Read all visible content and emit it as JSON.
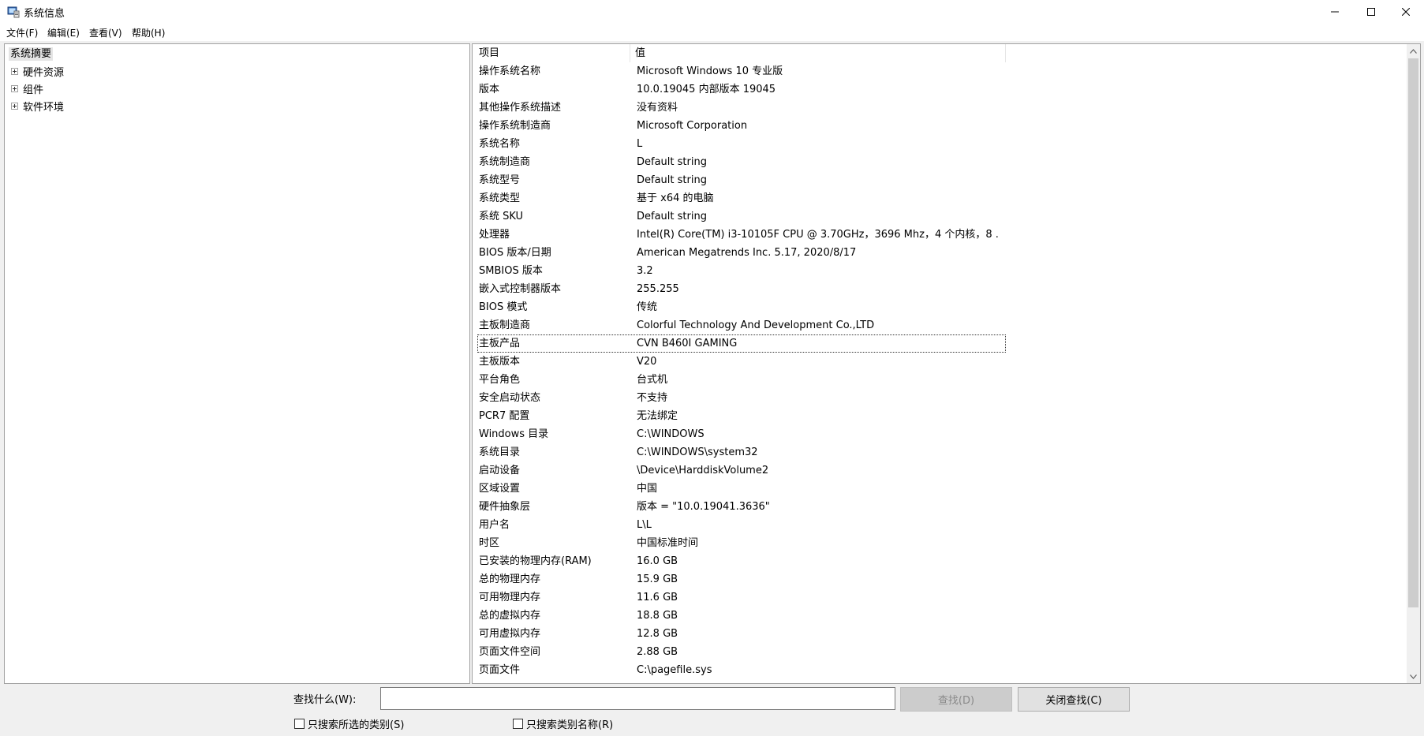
{
  "window": {
    "title": "系统信息",
    "minimize_glyph": "—",
    "maximize_glyph": "☐",
    "close_glyph": "✕"
  },
  "menu": [
    "文件(F)",
    "编辑(E)",
    "查看(V)",
    "帮助(H)"
  ],
  "tree": {
    "root": "系统摘要",
    "children": [
      "硬件资源",
      "组件",
      "软件环境"
    ]
  },
  "list": {
    "columns": {
      "item": "项目",
      "value": "值"
    },
    "focused_index": 15,
    "rows": [
      {
        "item": "操作系统名称",
        "value": "Microsoft Windows 10 专业版"
      },
      {
        "item": "版本",
        "value": "10.0.19045 内部版本 19045"
      },
      {
        "item": "其他操作系统描述",
        "value": "没有资料"
      },
      {
        "item": "操作系统制造商",
        "value": "Microsoft Corporation"
      },
      {
        "item": "系统名称",
        "value": "L"
      },
      {
        "item": "系统制造商",
        "value": "Default string"
      },
      {
        "item": "系统型号",
        "value": "Default string"
      },
      {
        "item": "系统类型",
        "value": "基于 x64 的电脑"
      },
      {
        "item": "系统 SKU",
        "value": "Default string"
      },
      {
        "item": "处理器",
        "value": "Intel(R) Core(TM) i3-10105F CPU @ 3.70GHz，3696 Mhz，4 个内核，8 ..."
      },
      {
        "item": "BIOS 版本/日期",
        "value": "American Megatrends Inc. 5.17, 2020/8/17"
      },
      {
        "item": "SMBIOS 版本",
        "value": "3.2"
      },
      {
        "item": "嵌入式控制器版本",
        "value": "255.255"
      },
      {
        "item": "BIOS 模式",
        "value": "传统"
      },
      {
        "item": "主板制造商",
        "value": "Colorful Technology And Development Co.,LTD"
      },
      {
        "item": "主板产品",
        "value": "CVN B460I GAMING"
      },
      {
        "item": "主板版本",
        "value": "V20"
      },
      {
        "item": "平台角色",
        "value": "台式机"
      },
      {
        "item": "安全启动状态",
        "value": "不支持"
      },
      {
        "item": "PCR7 配置",
        "value": "无法绑定"
      },
      {
        "item": "Windows 目录",
        "value": "C:\\WINDOWS"
      },
      {
        "item": "系统目录",
        "value": "C:\\WINDOWS\\system32"
      },
      {
        "item": "启动设备",
        "value": "\\Device\\HarddiskVolume2"
      },
      {
        "item": "区域设置",
        "value": "中国"
      },
      {
        "item": "硬件抽象层",
        "value": "版本 = \"10.0.19041.3636\""
      },
      {
        "item": "用户名",
        "value": "L\\L"
      },
      {
        "item": "时区",
        "value": "中国标准时间"
      },
      {
        "item": "已安装的物理内存(RAM)",
        "value": "16.0 GB"
      },
      {
        "item": "总的物理内存",
        "value": "15.9 GB"
      },
      {
        "item": "可用物理内存",
        "value": "11.6 GB"
      },
      {
        "item": "总的虚拟内存",
        "value": "18.8 GB"
      },
      {
        "item": "可用虚拟内存",
        "value": "12.8 GB"
      },
      {
        "item": "页面文件空间",
        "value": "2.88 GB"
      },
      {
        "item": "页面文件",
        "value": "C:\\pagefile.sys"
      }
    ]
  },
  "find": {
    "label": "查找什么(W):",
    "input_value": "",
    "find_button": "查找(D)",
    "close_button": "关闭查找(C)",
    "search_selected_label": "只搜索所选的类别(S)",
    "search_names_label": "只搜索类别名称(R)"
  },
  "colors": {
    "window_bg": "#f0f0f0",
    "pane_bg": "#ffffff",
    "tree_selected_bg": "#e5e5e5",
    "disabled_text": "#8a8a8a"
  }
}
